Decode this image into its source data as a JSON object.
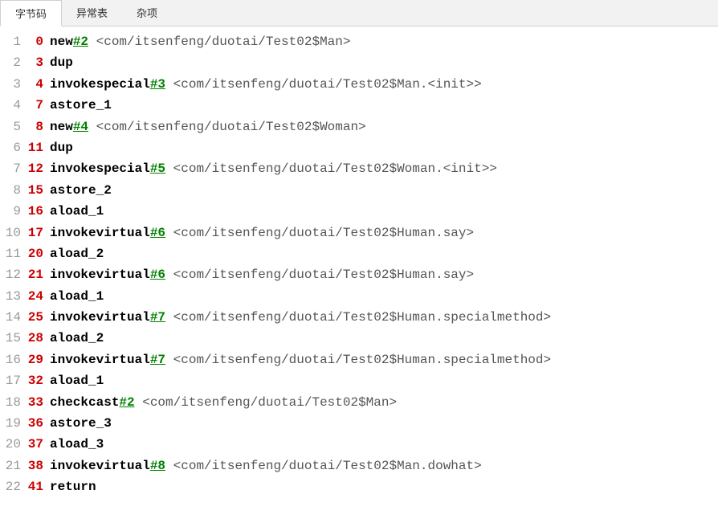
{
  "tabs": {
    "bytecode": "字节码",
    "exception_table": "异常表",
    "misc": "杂项"
  },
  "bytecode": {
    "lines": [
      {
        "n": "1",
        "pc": "0",
        "op": "new",
        "ref": "#2",
        "cmt": " <com/itsenfeng/duotai/Test02$Man>"
      },
      {
        "n": "2",
        "pc": "3",
        "op": "dup",
        "ref": "",
        "cmt": ""
      },
      {
        "n": "3",
        "pc": "4",
        "op": "invokespecial",
        "ref": "#3",
        "cmt": " <com/itsenfeng/duotai/Test02$Man.<init>>"
      },
      {
        "n": "4",
        "pc": "7",
        "op": "astore_1",
        "ref": "",
        "cmt": ""
      },
      {
        "n": "5",
        "pc": "8",
        "op": "new",
        "ref": "#4",
        "cmt": " <com/itsenfeng/duotai/Test02$Woman>"
      },
      {
        "n": "6",
        "pc": "11",
        "op": "dup",
        "ref": "",
        "cmt": ""
      },
      {
        "n": "7",
        "pc": "12",
        "op": "invokespecial",
        "ref": "#5",
        "cmt": " <com/itsenfeng/duotai/Test02$Woman.<init>>"
      },
      {
        "n": "8",
        "pc": "15",
        "op": "astore_2",
        "ref": "",
        "cmt": ""
      },
      {
        "n": "9",
        "pc": "16",
        "op": "aload_1",
        "ref": "",
        "cmt": ""
      },
      {
        "n": "10",
        "pc": "17",
        "op": "invokevirtual",
        "ref": "#6",
        "cmt": " <com/itsenfeng/duotai/Test02$Human.say>"
      },
      {
        "n": "11",
        "pc": "20",
        "op": "aload_2",
        "ref": "",
        "cmt": ""
      },
      {
        "n": "12",
        "pc": "21",
        "op": "invokevirtual",
        "ref": "#6",
        "cmt": " <com/itsenfeng/duotai/Test02$Human.say>"
      },
      {
        "n": "13",
        "pc": "24",
        "op": "aload_1",
        "ref": "",
        "cmt": ""
      },
      {
        "n": "14",
        "pc": "25",
        "op": "invokevirtual",
        "ref": "#7",
        "cmt": " <com/itsenfeng/duotai/Test02$Human.specialmethod>"
      },
      {
        "n": "15",
        "pc": "28",
        "op": "aload_2",
        "ref": "",
        "cmt": ""
      },
      {
        "n": "16",
        "pc": "29",
        "op": "invokevirtual",
        "ref": "#7",
        "cmt": " <com/itsenfeng/duotai/Test02$Human.specialmethod>"
      },
      {
        "n": "17",
        "pc": "32",
        "op": "aload_1",
        "ref": "",
        "cmt": ""
      },
      {
        "n": "18",
        "pc": "33",
        "op": "checkcast",
        "ref": "#2",
        "cmt": " <com/itsenfeng/duotai/Test02$Man>"
      },
      {
        "n": "19",
        "pc": "36",
        "op": "astore_3",
        "ref": "",
        "cmt": ""
      },
      {
        "n": "20",
        "pc": "37",
        "op": "aload_3",
        "ref": "",
        "cmt": ""
      },
      {
        "n": "21",
        "pc": "38",
        "op": "invokevirtual",
        "ref": "#8",
        "cmt": " <com/itsenfeng/duotai/Test02$Man.dowhat>"
      },
      {
        "n": "22",
        "pc": "41",
        "op": "return",
        "ref": "",
        "cmt": ""
      }
    ]
  }
}
